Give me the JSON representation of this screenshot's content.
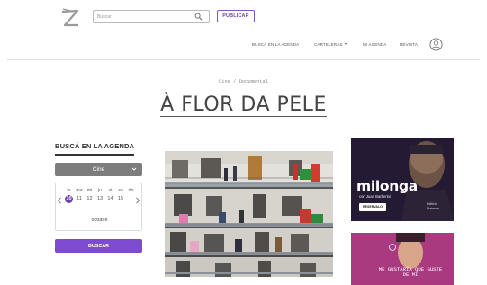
{
  "header": {
    "search_placeholder": "Buscar",
    "publish_label": "PUBLICAR"
  },
  "nav": {
    "items": [
      "BUSCÁ EN LA AGENDA",
      "CARTELERAS",
      "MI AGENDA",
      "REVISTA"
    ]
  },
  "page": {
    "breadcrumb": "Cine / Documental",
    "title": "À FLOR DA PELE"
  },
  "sidebar": {
    "heading": "BUSCÁ EN LA AGENDA",
    "category_value": "Cine",
    "calendar": {
      "days": [
        "lu",
        "ma",
        "mi",
        "ju",
        "vi",
        "sa",
        "do"
      ],
      "dates": [
        "10",
        "11",
        "12",
        "13",
        "14",
        "15"
      ],
      "selected_date": "10",
      "month": "octubre"
    },
    "search_button": "BUSCAR"
  },
  "ads": {
    "milonga": {
      "brand": "milonga",
      "subtitle": "con Juan Barberini",
      "cta": "RESERVALO",
      "corner": "Edificio Platense"
    },
    "bottom": {
      "quote": "ME GUSTARÍA QUE GUSTE DE MÍ"
    }
  },
  "colors": {
    "accent": "#7c4bd0",
    "selected_day": "#6f3db5",
    "select_bg": "#7d7d7d"
  },
  "icons": {
    "logo": "z-logo-icon",
    "search": "search-icon",
    "user": "user-icon",
    "dropdown": "chevron-down-icon",
    "prev": "chevron-left-icon",
    "next": "chevron-right-icon"
  }
}
